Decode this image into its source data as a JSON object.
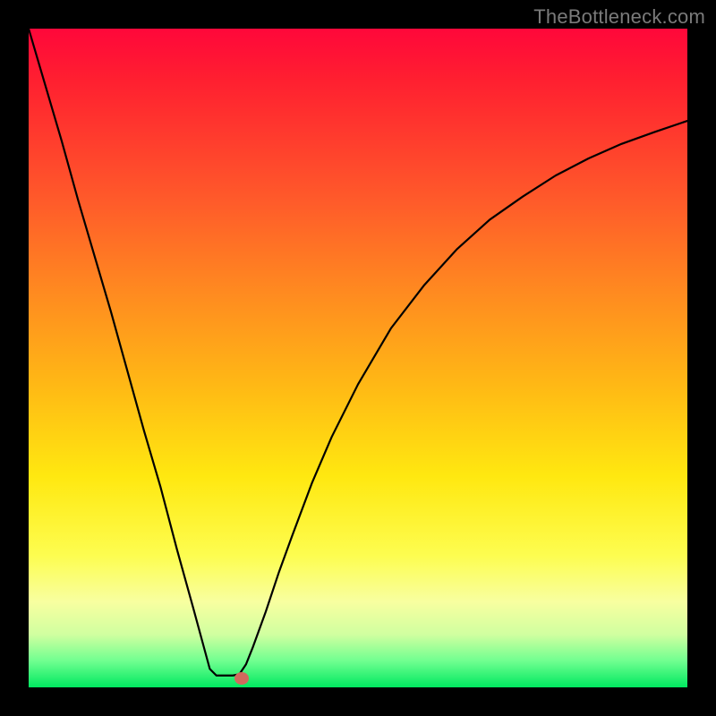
{
  "watermark": "TheBottleneck.com",
  "colors": {
    "frame": "#000000",
    "curve": "#000000",
    "dot": "#d06a5d",
    "gradient_top": "#ff073a",
    "gradient_bottom": "#00e860"
  },
  "chart_data": {
    "type": "line",
    "title": "",
    "xlabel": "",
    "ylabel": "",
    "xlim": [
      0,
      1
    ],
    "ylim": [
      0,
      1
    ],
    "grid": false,
    "x": [
      0.0,
      0.025,
      0.05,
      0.075,
      0.1,
      0.125,
      0.15,
      0.175,
      0.2,
      0.225,
      0.25,
      0.275,
      0.285,
      0.295,
      0.3,
      0.31,
      0.32,
      0.33,
      0.34,
      0.36,
      0.38,
      0.4,
      0.43,
      0.46,
      0.5,
      0.55,
      0.6,
      0.65,
      0.7,
      0.75,
      0.8,
      0.85,
      0.9,
      0.95,
      1.0
    ],
    "y": [
      1.0,
      0.915,
      0.83,
      0.74,
      0.655,
      0.57,
      0.48,
      0.39,
      0.305,
      0.21,
      0.12,
      0.028,
      0.018,
      0.018,
      0.018,
      0.018,
      0.02,
      0.035,
      0.06,
      0.115,
      0.175,
      0.23,
      0.31,
      0.38,
      0.46,
      0.545,
      0.61,
      0.665,
      0.71,
      0.745,
      0.777,
      0.803,
      0.825,
      0.843,
      0.86
    ],
    "annotations": [
      {
        "type": "dot",
        "x": 0.323,
        "y": 0.014
      }
    ]
  }
}
